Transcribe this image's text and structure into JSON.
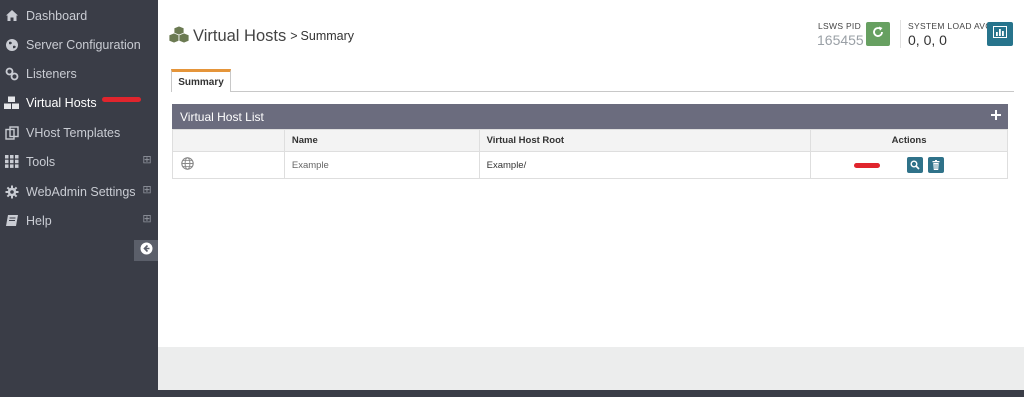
{
  "sidebar": {
    "items": [
      {
        "label": "Dashboard",
        "icon": "home-icon"
      },
      {
        "label": "Server Configuration",
        "icon": "globe-icon"
      },
      {
        "label": "Listeners",
        "icon": "link-icon"
      },
      {
        "label": "Virtual Hosts",
        "icon": "cubes-icon",
        "active": true
      },
      {
        "label": "VHost Templates",
        "icon": "copy-icon"
      },
      {
        "label": "Tools",
        "icon": "grid-icon",
        "expand": "⊞"
      },
      {
        "label": "WebAdmin Settings",
        "icon": "gear-icon",
        "expand": "⊞"
      },
      {
        "label": "Help",
        "icon": "book-icon",
        "expand": "⊞"
      }
    ],
    "collapse_icon": "arrow-left-circle-icon"
  },
  "header": {
    "title": "Virtual Hosts",
    "separator": ">",
    "subtitle": "Summary",
    "pid_label": "LSWS PID",
    "pid_value": "165455",
    "load_label": "SYSTEM LOAD AVG",
    "load_value": "0, 0, 0"
  },
  "tabs": [
    {
      "label": "Summary",
      "active": true
    }
  ],
  "panel": {
    "title": "Virtual Host List",
    "columns": [
      "",
      "Name",
      "Virtual Host Root",
      "Actions"
    ],
    "rows": [
      {
        "icon": "globe-icon",
        "name": "Example",
        "root": "Example/",
        "actions": [
          "view-icon",
          "trash-icon"
        ]
      }
    ]
  },
  "colors": {
    "sidebar_bg": "#3a3d47",
    "panel_header": "#6b6c7e",
    "tab_accent": "#e5953a",
    "restart_green": "#67a061",
    "action_teal": "#2f7289",
    "annotation_red": "#e0252d"
  }
}
